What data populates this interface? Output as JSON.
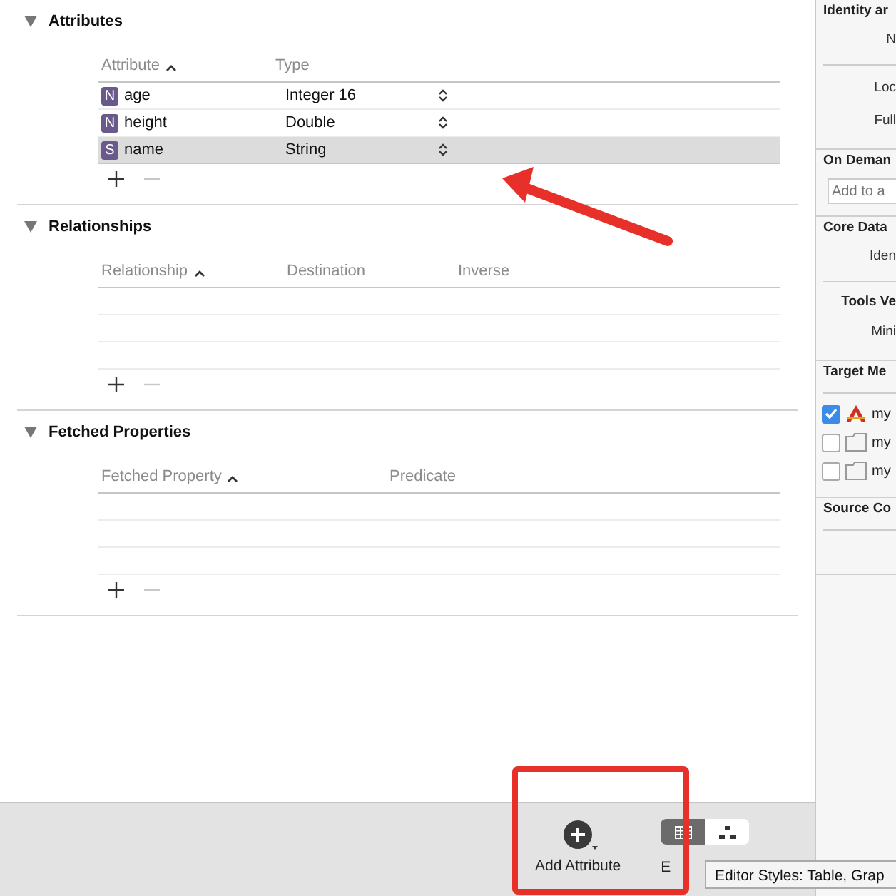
{
  "sections": [
    {
      "title": "Attributes",
      "expanded": true,
      "columns": [
        {
          "label": "Attribute",
          "sorted": true
        },
        {
          "label": "Type",
          "sorted": false
        }
      ],
      "rows": [
        {
          "badge": "N",
          "name": "age",
          "type": "Integer 16",
          "selected": false
        },
        {
          "badge": "N",
          "name": "height",
          "type": "Double",
          "selected": false
        },
        {
          "badge": "S",
          "name": "name",
          "type": "String",
          "selected": true
        }
      ]
    },
    {
      "title": "Relationships",
      "expanded": true,
      "columns": [
        {
          "label": "Relationship",
          "sorted": true
        },
        {
          "label": "Destination",
          "sorted": false
        },
        {
          "label": "Inverse",
          "sorted": false
        }
      ]
    },
    {
      "title": "Fetched Properties",
      "expanded": true,
      "columns": [
        {
          "label": "Fetched Property",
          "sorted": true
        },
        {
          "label": "Predicate",
          "sorted": false
        }
      ]
    }
  ],
  "toolbar": {
    "add_button": {
      "label": "Add Attribute"
    },
    "editor_style": {
      "label": "E",
      "options": [
        {
          "kind": "table",
          "selected": true
        },
        {
          "kind": "graph",
          "selected": false
        }
      ]
    },
    "tooltip": "Editor Styles: Table, Grap"
  },
  "inspector": [
    {
      "title": "Identity ar",
      "items": [
        {
          "kind": "label",
          "text": "N"
        },
        {
          "kind": "rule"
        },
        {
          "kind": "label",
          "text": "Loc"
        },
        {
          "kind": "label",
          "text": "Full"
        }
      ]
    },
    {
      "title": "On Deman",
      "items": [
        {
          "kind": "field",
          "placeholder": "Add to a"
        }
      ]
    },
    {
      "title": "Core Data",
      "items": [
        {
          "kind": "label",
          "text": "Iden"
        },
        {
          "kind": "rule"
        },
        {
          "kind": "subheader",
          "text": "Tools Ve"
        },
        {
          "kind": "label",
          "text": "Mini"
        }
      ]
    },
    {
      "title": "Target Me",
      "items": [
        {
          "kind": "rule"
        },
        {
          "kind": "check",
          "checked": true,
          "text": "my"
        },
        {
          "kind": "check",
          "checked": false,
          "text": "my"
        },
        {
          "kind": "check",
          "checked": false,
          "text": "my"
        }
      ]
    },
    {
      "title": "Source Co",
      "items": [
        {
          "kind": "rule"
        },
        {
          "kind": "blank"
        }
      ]
    }
  ]
}
